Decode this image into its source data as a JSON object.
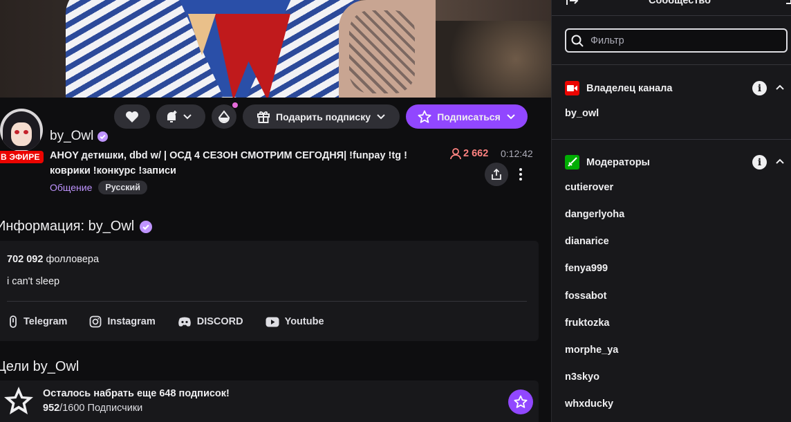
{
  "video": {
    "description_icon": "stream-video-frame"
  },
  "channel": {
    "name": "by_Owl",
    "live_badge": "В ЭФИРЕ",
    "title": "AHOY детишки, dbd w/ | ОСД 4 СЕЗОН СМОТРИМ СЕГОДНЯ| !funpay !tg !коврики !конкурс !записи",
    "category": "Общение",
    "language_tag": "Русский",
    "viewers": "2 662",
    "uptime": "0:12:42"
  },
  "actions": {
    "gift_label": "Подарить подписку",
    "subscribe_label": "Подписаться"
  },
  "about": {
    "heading": "Информация: by_Owl",
    "followers_count": "702 092",
    "followers_label": "фолловера",
    "bio": "i can't sleep",
    "socials": [
      {
        "label": "Telegram",
        "icon": "telegram-icon"
      },
      {
        "label": "Instagram",
        "icon": "instagram-icon"
      },
      {
        "label": "DISCORD",
        "icon": "discord-icon"
      },
      {
        "label": "Youtube",
        "icon": "youtube-icon"
      }
    ]
  },
  "goals": {
    "heading": "Цели by_Owl",
    "title": "Осталось набрать еще 648 подписок!",
    "current": "952",
    "target_text": "/1600 Подписчики",
    "progress_fraction": 0.595
  },
  "community": {
    "title": "Сообщество",
    "filter_placeholder": "Фильтр",
    "owner_section": "Владелец канала",
    "owner": "by_owl",
    "mods_section": "Модераторы",
    "mods": [
      "cutierover",
      "dangerlyoha",
      "dianarice",
      "fenya999",
      "fossabot",
      "fruktozka",
      "morphe_ya",
      "n3skyo",
      "whxducky"
    ]
  },
  "colors": {
    "accent": "#9147ff",
    "live": "#eb0400",
    "viewers": "#ff8280",
    "category": "#bf94ff",
    "moderator": "#00ad03"
  }
}
